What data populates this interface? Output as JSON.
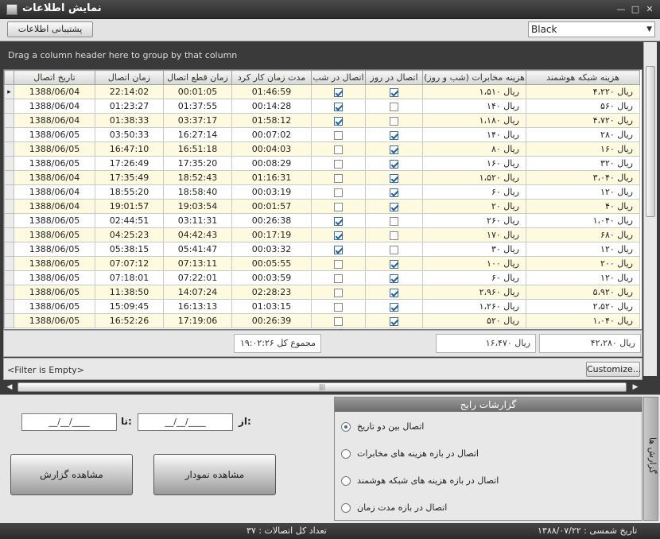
{
  "window": {
    "title": "نمایش اطلاعات"
  },
  "toolbar": {
    "backup_label": "پشتیبانی اطلاعات",
    "theme_value": "Black"
  },
  "grid": {
    "group_hint": "Drag a column header here to group by that column",
    "columns": [
      "تاریخ اتصال",
      "زمان اتصال",
      "زمان قطع اتصال",
      "مدت زمان کار کرد",
      "اتصال در شب",
      "اتصال در روز",
      "هزینه مخابرات (شب و روز)",
      "هزینه شبکه هوشمند"
    ],
    "rows": [
      {
        "date": "1388/06/04",
        "start": "22:14:02",
        "end": "00:01:05",
        "duration": "01:46:59",
        "night": true,
        "day": true,
        "telecom": "ریال ۱،۵۱۰",
        "network": "ریال ۴،۲۲۰"
      },
      {
        "date": "1388/06/04",
        "start": "01:23:27",
        "end": "01:37:55",
        "duration": "00:14:28",
        "night": true,
        "day": false,
        "telecom": "ریال ۱۴۰",
        "network": "ریال ۵۶۰"
      },
      {
        "date": "1388/06/04",
        "start": "01:38:33",
        "end": "03:37:17",
        "duration": "01:58:12",
        "night": true,
        "day": false,
        "telecom": "ریال ۱،۱۸۰",
        "network": "ریال ۴،۷۲۰"
      },
      {
        "date": "1388/06/05",
        "start": "03:50:33",
        "end": "16:27:14",
        "duration": "00:07:02",
        "night": false,
        "day": true,
        "telecom": "ریال ۱۴۰",
        "network": "ریال ۲۸۰"
      },
      {
        "date": "1388/06/05",
        "start": "16:47:10",
        "end": "16:51:18",
        "duration": "00:04:03",
        "night": false,
        "day": true,
        "telecom": "ریال ۸۰",
        "network": "ریال ۱۶۰"
      },
      {
        "date": "1388/06/05",
        "start": "17:26:49",
        "end": "17:35:20",
        "duration": "00:08:29",
        "night": false,
        "day": true,
        "telecom": "ریال ۱۶۰",
        "network": "ریال ۳۲۰"
      },
      {
        "date": "1388/06/04",
        "start": "17:35:49",
        "end": "18:52:43",
        "duration": "01:16:31",
        "night": false,
        "day": true,
        "telecom": "ریال ۱،۵۲۰",
        "network": "ریال ۳،۰۴۰"
      },
      {
        "date": "1388/06/04",
        "start": "18:55:20",
        "end": "18:58:40",
        "duration": "00:03:19",
        "night": false,
        "day": true,
        "telecom": "ریال ۶۰",
        "network": "ریال ۱۲۰"
      },
      {
        "date": "1388/06/04",
        "start": "19:01:57",
        "end": "19:03:54",
        "duration": "00:01:57",
        "night": false,
        "day": true,
        "telecom": "ریال ۲۰",
        "network": "ریال ۴۰"
      },
      {
        "date": "1388/06/05",
        "start": "02:44:51",
        "end": "03:11:31",
        "duration": "00:26:38",
        "night": true,
        "day": false,
        "telecom": "ریال ۲۶۰",
        "network": "ریال ۱،۰۴۰"
      },
      {
        "date": "1388/06/05",
        "start": "04:25:23",
        "end": "04:42:43",
        "duration": "00:17:19",
        "night": true,
        "day": false,
        "telecom": "ریال ۱۷۰",
        "network": "ریال ۶۸۰"
      },
      {
        "date": "1388/06/05",
        "start": "05:38:15",
        "end": "05:41:47",
        "duration": "00:03:32",
        "night": true,
        "day": false,
        "telecom": "ریال ۳۰",
        "network": "ریال ۱۲۰"
      },
      {
        "date": "1388/06/05",
        "start": "07:07:12",
        "end": "07:13:11",
        "duration": "00:05:55",
        "night": false,
        "day": true,
        "telecom": "ریال ۱۰۰",
        "network": "ریال ۲۰۰"
      },
      {
        "date": "1388/06/05",
        "start": "07:18:01",
        "end": "07:22:01",
        "duration": "00:03:59",
        "night": false,
        "day": true,
        "telecom": "ریال ۶۰",
        "network": "ریال ۱۲۰"
      },
      {
        "date": "1388/06/05",
        "start": "11:38:50",
        "end": "14:07:24",
        "duration": "02:28:23",
        "night": false,
        "day": true,
        "telecom": "ریال ۲،۹۶۰",
        "network": "ریال ۵،۹۲۰"
      },
      {
        "date": "1388/06/05",
        "start": "15:09:45",
        "end": "16:13:13",
        "duration": "01:03:15",
        "night": false,
        "day": true,
        "telecom": "ریال ۱،۲۶۰",
        "network": "ریال ۲،۵۲۰"
      },
      {
        "date": "1388/06/05",
        "start": "16:52:26",
        "end": "17:19:06",
        "duration": "00:26:39",
        "night": false,
        "day": true,
        "telecom": "ریال ۵۲۰",
        "network": "ریال ۱،۰۴۰"
      }
    ],
    "totals": {
      "duration": "مجموع کل ۱۹:۰۲:۲۶",
      "telecom": "ریال ۱۶،۴۷۰",
      "network": "ریال ۴۲،۲۸۰"
    },
    "filter_text": "<Filter is Empty>",
    "customize_label": "Customize..."
  },
  "query": {
    "from_label": "از:",
    "to_label": "تا:",
    "from_value": "__/__/____",
    "to_value": "__/__/____",
    "show_report_label": "مشاهده گزارش",
    "show_chart_label": "مشاهده نمودار"
  },
  "reports": {
    "header": "گزارشات رایج",
    "options": [
      {
        "label": "اتصال بین دو تاریخ",
        "selected": true
      },
      {
        "label": "اتصال در بازه هزینه های مخابرات",
        "selected": false
      },
      {
        "label": "اتصال در بازه هزینه های شبکه هوشمند",
        "selected": false
      },
      {
        "label": "اتصال در بازه مدت زمان",
        "selected": false
      }
    ],
    "side_tab": "گزارش ها"
  },
  "status": {
    "total_connections": "تعداد کل اتصالات : ۳۷",
    "date": "تاریخ شمسی : ۱۳۸۸/۰۷/۲۲"
  }
}
